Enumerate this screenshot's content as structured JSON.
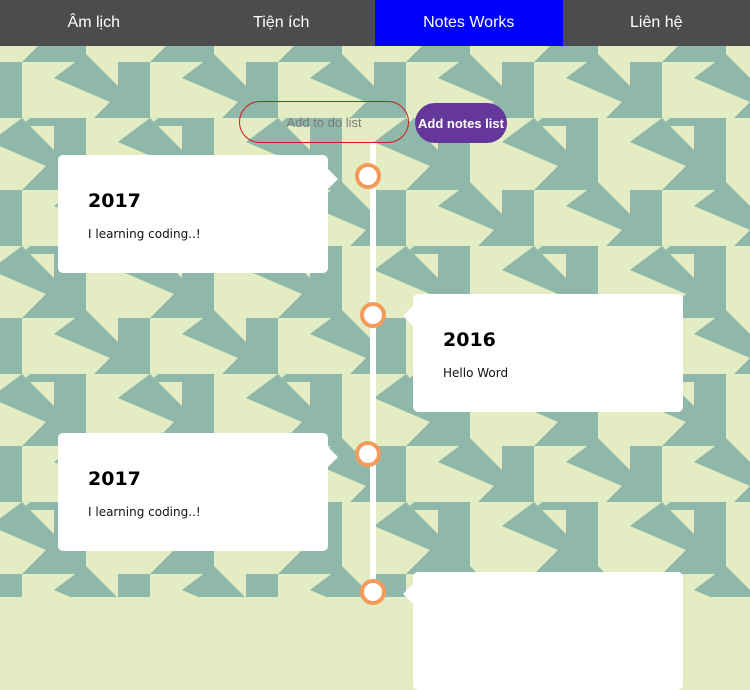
{
  "nav": {
    "items": [
      {
        "label": "Âm lịch"
      },
      {
        "label": "Tiện ích"
      },
      {
        "label": "Notes Works"
      },
      {
        "label": "Liên hệ"
      }
    ]
  },
  "todo": {
    "placeholder": "Add to do list",
    "button_label": "Add notes list"
  },
  "timeline": {
    "entries": [
      {
        "year": "2017",
        "text": "I learning coding..!"
      },
      {
        "year": "2016",
        "text": "Hello Word"
      },
      {
        "year": "2017",
        "text": "I learning coding..!"
      },
      {
        "year": "",
        "text": ""
      }
    ]
  },
  "colors": {
    "nav_bg": "#4c4c4c",
    "nav_active": "#0000ff",
    "accent_button": "#65379a",
    "marker_border": "#f49a5b",
    "input_border": "#cc1b1b",
    "pattern_light": "#e3ecc2",
    "pattern_dark": "#8fb8ab"
  }
}
